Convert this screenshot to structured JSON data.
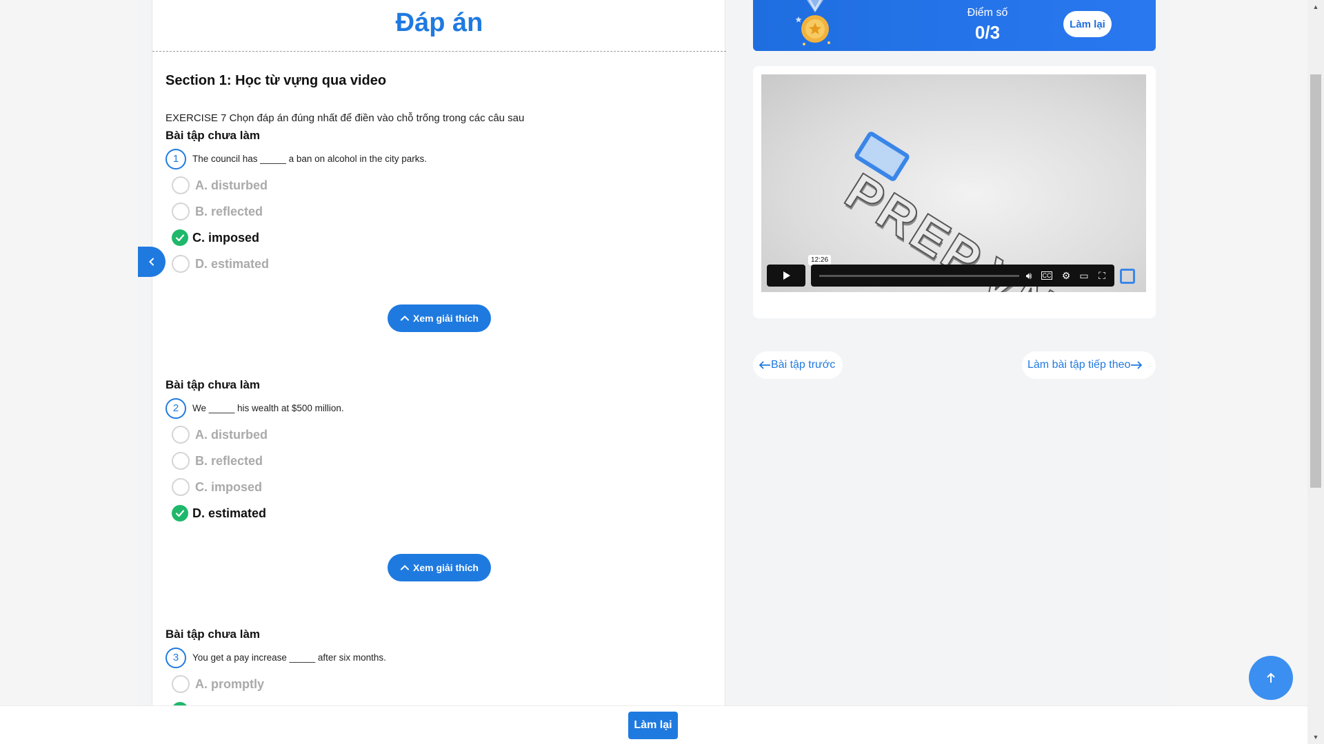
{
  "panel": {
    "title": "Đáp án"
  },
  "section": {
    "title": "Section 1: Học từ vựng qua video"
  },
  "exercise": {
    "description": "EXERCISE 7 Chọn đáp án đúng nhất để điền vào chỗ trống trong các câu sau"
  },
  "questions": [
    {
      "status": "Bài tập chưa làm",
      "number": "1",
      "text": "The council has _____ a ban on alcohol in the city parks.",
      "options": [
        "A. disturbed",
        "B. reflected",
        "C. imposed",
        "D. estimated"
      ],
      "correct_index": 2,
      "explain_label": "Xem giải thích"
    },
    {
      "status": "Bài tập chưa làm",
      "number": "2",
      "text": "We _____ his wealth at $500 million.",
      "options": [
        "A. disturbed",
        "B. reflected",
        "C. imposed",
        "D. estimated"
      ],
      "correct_index": 3,
      "explain_label": "Xem giải thích"
    },
    {
      "status": "Bài tập chưa làm",
      "number": "3",
      "text": "You get a pay increase _____ after six months.",
      "options": [
        "A. promptly"
      ]
    }
  ],
  "score": {
    "label": "Điểm số",
    "value": "0/3",
    "retry_label": "Làm lại"
  },
  "video": {
    "brand": "PREP.VN",
    "time_tooltip": "12:26"
  },
  "nav": {
    "prev_label": "Bài tập trước",
    "next_label": "Làm bài tập tiếp theo"
  },
  "bottom": {
    "retry_label": "Làm lại"
  },
  "colors": {
    "primary": "#1f7ae0",
    "correct": "#1fb86b",
    "banner": "#2a78f0"
  }
}
